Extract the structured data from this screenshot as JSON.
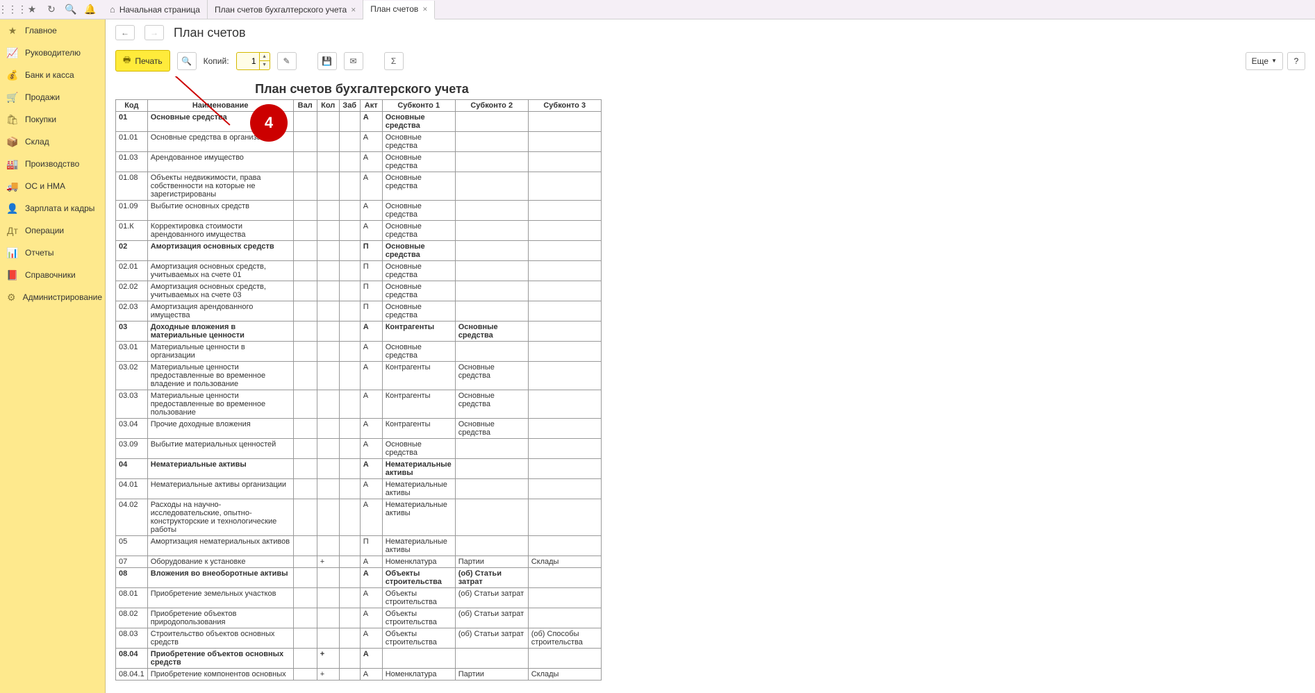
{
  "topbar": {
    "tabs": [
      {
        "label": "Начальная страница",
        "hasHome": true,
        "closable": false
      },
      {
        "label": "План счетов бухгалтерского учета",
        "closable": true
      },
      {
        "label": "План счетов",
        "closable": true,
        "active": true
      }
    ]
  },
  "sidebar": {
    "items": [
      {
        "label": "Главное",
        "icon": "★"
      },
      {
        "label": "Руководителю",
        "icon": "📈"
      },
      {
        "label": "Банк и касса",
        "icon": "💰"
      },
      {
        "label": "Продажи",
        "icon": "🛒"
      },
      {
        "label": "Покупки",
        "icon": "🛍"
      },
      {
        "label": "Склад",
        "icon": "📦"
      },
      {
        "label": "Производство",
        "icon": "🏭"
      },
      {
        "label": "ОС и НМА",
        "icon": "🚚"
      },
      {
        "label": "Зарплата и кадры",
        "icon": "👤"
      },
      {
        "label": "Операции",
        "icon": "Дт"
      },
      {
        "label": "Отчеты",
        "icon": "📊"
      },
      {
        "label": "Справочники",
        "icon": "📕"
      },
      {
        "label": "Администрирование",
        "icon": "⚙"
      }
    ]
  },
  "page": {
    "title": "План счетов"
  },
  "toolbar": {
    "print_label": "Печать",
    "copies_label": "Копий:",
    "copies_value": "1",
    "more_label": "Еще"
  },
  "report": {
    "title": "План счетов бухгалтерского учета",
    "columns": [
      "Код",
      "Наименование",
      "Вал",
      "Кол",
      "Заб",
      "Акт",
      "Субконто 1",
      "Субконто 2",
      "Субконто 3"
    ],
    "rows": [
      {
        "code": "01",
        "name": "Основные средства",
        "akt": "А",
        "s1": "Основные средства",
        "bold": true
      },
      {
        "code": "01.01",
        "name": "Основные средства в организации",
        "akt": "А",
        "s1": "Основные средства"
      },
      {
        "code": "01.03",
        "name": "Арендованное имущество",
        "akt": "А",
        "s1": "Основные средства"
      },
      {
        "code": "01.08",
        "name": "Объекты недвижимости, права собственности на которые не зарегистрированы",
        "akt": "А",
        "s1": "Основные средства"
      },
      {
        "code": "01.09",
        "name": "Выбытие основных средств",
        "akt": "А",
        "s1": "Основные средства"
      },
      {
        "code": "01.К",
        "name": "Корректировка стоимости арендованного имущества",
        "akt": "А",
        "s1": "Основные средства"
      },
      {
        "code": "02",
        "name": "Амортизация основных средств",
        "akt": "П",
        "s1": "Основные средства",
        "bold": true
      },
      {
        "code": "02.01",
        "name": "Амортизация основных средств, учитываемых на счете 01",
        "akt": "П",
        "s1": "Основные средства"
      },
      {
        "code": "02.02",
        "name": "Амортизация основных средств, учитываемых на счете 03",
        "akt": "П",
        "s1": "Основные средства"
      },
      {
        "code": "02.03",
        "name": "Амортизация арендованного имущества",
        "akt": "П",
        "s1": "Основные средства"
      },
      {
        "code": "03",
        "name": "Доходные вложения в материальные ценности",
        "akt": "А",
        "s1": "Контрагенты",
        "s2": "Основные средства",
        "bold": true
      },
      {
        "code": "03.01",
        "name": "Материальные ценности в организации",
        "akt": "А",
        "s1": "Основные средства"
      },
      {
        "code": "03.02",
        "name": "Материальные ценности предоставленные во временное владение и пользование",
        "akt": "А",
        "s1": "Контрагенты",
        "s2": "Основные средства"
      },
      {
        "code": "03.03",
        "name": "Материальные ценности предоставленные во временное пользование",
        "akt": "А",
        "s1": "Контрагенты",
        "s2": "Основные средства"
      },
      {
        "code": "03.04",
        "name": "Прочие доходные вложения",
        "akt": "А",
        "s1": "Контрагенты",
        "s2": "Основные средства"
      },
      {
        "code": "03.09",
        "name": "Выбытие материальных ценностей",
        "akt": "А",
        "s1": "Основные средства"
      },
      {
        "code": "04",
        "name": "Нематериальные активы",
        "akt": "А",
        "s1": "Нематериальные активы",
        "bold": true
      },
      {
        "code": "04.01",
        "name": "Нематериальные активы организации",
        "akt": "А",
        "s1": "Нематериальные активы"
      },
      {
        "code": "04.02",
        "name": "Расходы на научно-исследовательские, опытно-конструкторские и технологические работы",
        "akt": "А",
        "s1": "Нематериальные активы"
      },
      {
        "code": "05",
        "name": "Амортизация нематериальных активов",
        "akt": "П",
        "s1": "Нематериальные активы"
      },
      {
        "code": "07",
        "name": "Оборудование к установке",
        "kol": "+",
        "akt": "А",
        "s1": "Номенклатура",
        "s2": "Партии",
        "s3": "Склады"
      },
      {
        "code": "08",
        "name": "Вложения во внеоборотные активы",
        "akt": "А",
        "s1": "Объекты строительства",
        "s2": "(об) Статьи затрат",
        "bold": true
      },
      {
        "code": "08.01",
        "name": "Приобретение земельных участков",
        "akt": "А",
        "s1": "Объекты строительства",
        "s2": "(об) Статьи затрат"
      },
      {
        "code": "08.02",
        "name": "Приобретение объектов природопользования",
        "akt": "А",
        "s1": "Объекты строительства",
        "s2": "(об) Статьи затрат"
      },
      {
        "code": "08.03",
        "name": "Строительство объектов основных средств",
        "akt": "А",
        "s1": "Объекты строительства",
        "s2": "(об) Статьи затрат",
        "s3": "(об) Способы строительства"
      },
      {
        "code": "08.04",
        "name": "Приобретение объектов основных средств",
        "kol": "+",
        "akt": "А",
        "bold": true
      },
      {
        "code": "08.04.1",
        "name": "Приобретение компонентов основных",
        "kol": "+",
        "akt": "А",
        "s1": "Номенклатура",
        "s2": "Партии",
        "s3": "Склады"
      }
    ]
  },
  "annotation": {
    "number": "4"
  }
}
